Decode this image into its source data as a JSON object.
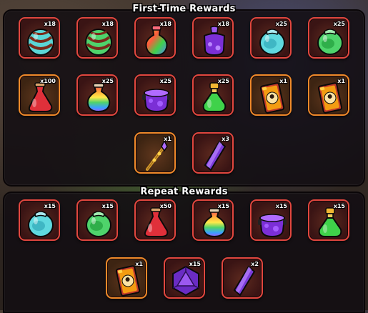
{
  "sections": [
    {
      "title": "First-Time Rewards",
      "rows": [
        [
          {
            "icon": "striped-teal-orb-icon",
            "qty": "x18",
            "border": "red"
          },
          {
            "icon": "striped-green-orb-icon",
            "qty": "x18",
            "border": "red"
          },
          {
            "icon": "rainbow-potion-icon",
            "qty": "x18",
            "border": "red"
          },
          {
            "icon": "purple-cauldron-potion-icon",
            "qty": "x18",
            "border": "red"
          },
          {
            "icon": "teal-jar-potion-icon",
            "qty": "x25",
            "border": "red"
          },
          {
            "icon": "green-jar-potion-icon",
            "qty": "x25",
            "border": "red"
          }
        ],
        [
          {
            "icon": "red-flask-potion-icon",
            "qty": "x100",
            "border": "orange"
          },
          {
            "icon": "rainbow-flask-potion-icon",
            "qty": "x25",
            "border": "red"
          },
          {
            "icon": "purple-cauldron-icon",
            "qty": "x25",
            "border": "red"
          },
          {
            "icon": "green-gold-potion-icon",
            "qty": "x25",
            "border": "red"
          },
          {
            "icon": "fire-card-icon",
            "qty": "x1",
            "border": "orange"
          },
          {
            "icon": "fire-card-icon",
            "qty": "x1",
            "border": "orange"
          }
        ],
        [
          {
            "icon": "golden-staff-icon",
            "qty": "x1",
            "border": "orange"
          },
          {
            "icon": "purple-crystal-icon",
            "qty": "x3",
            "border": "red"
          }
        ]
      ]
    },
    {
      "title": "Repeat Rewards",
      "rows": [
        [
          {
            "icon": "teal-jar-potion-icon",
            "qty": "x15",
            "border": "red"
          },
          {
            "icon": "green-jar-potion-icon",
            "qty": "x15",
            "border": "red"
          },
          {
            "icon": "red-flask-potion-icon",
            "qty": "x50",
            "border": "red"
          },
          {
            "icon": "rainbow-flask-potion-icon",
            "qty": "x15",
            "border": "red"
          },
          {
            "icon": "purple-cauldron-icon",
            "qty": "x15",
            "border": "red"
          },
          {
            "icon": "green-gold-potion-icon",
            "qty": "x15",
            "border": "red"
          }
        ],
        [
          {
            "icon": "fire-card-icon",
            "qty": "x1",
            "border": "orange"
          },
          {
            "icon": "purple-dice-icon",
            "qty": "x15",
            "border": "red"
          },
          {
            "icon": "purple-crystal-icon",
            "qty": "x2",
            "border": "red"
          }
        ]
      ]
    }
  ],
  "colors": {
    "border_red": "#e2473f",
    "border_orange": "#f08a2a",
    "panel_bg": "#120e12"
  }
}
